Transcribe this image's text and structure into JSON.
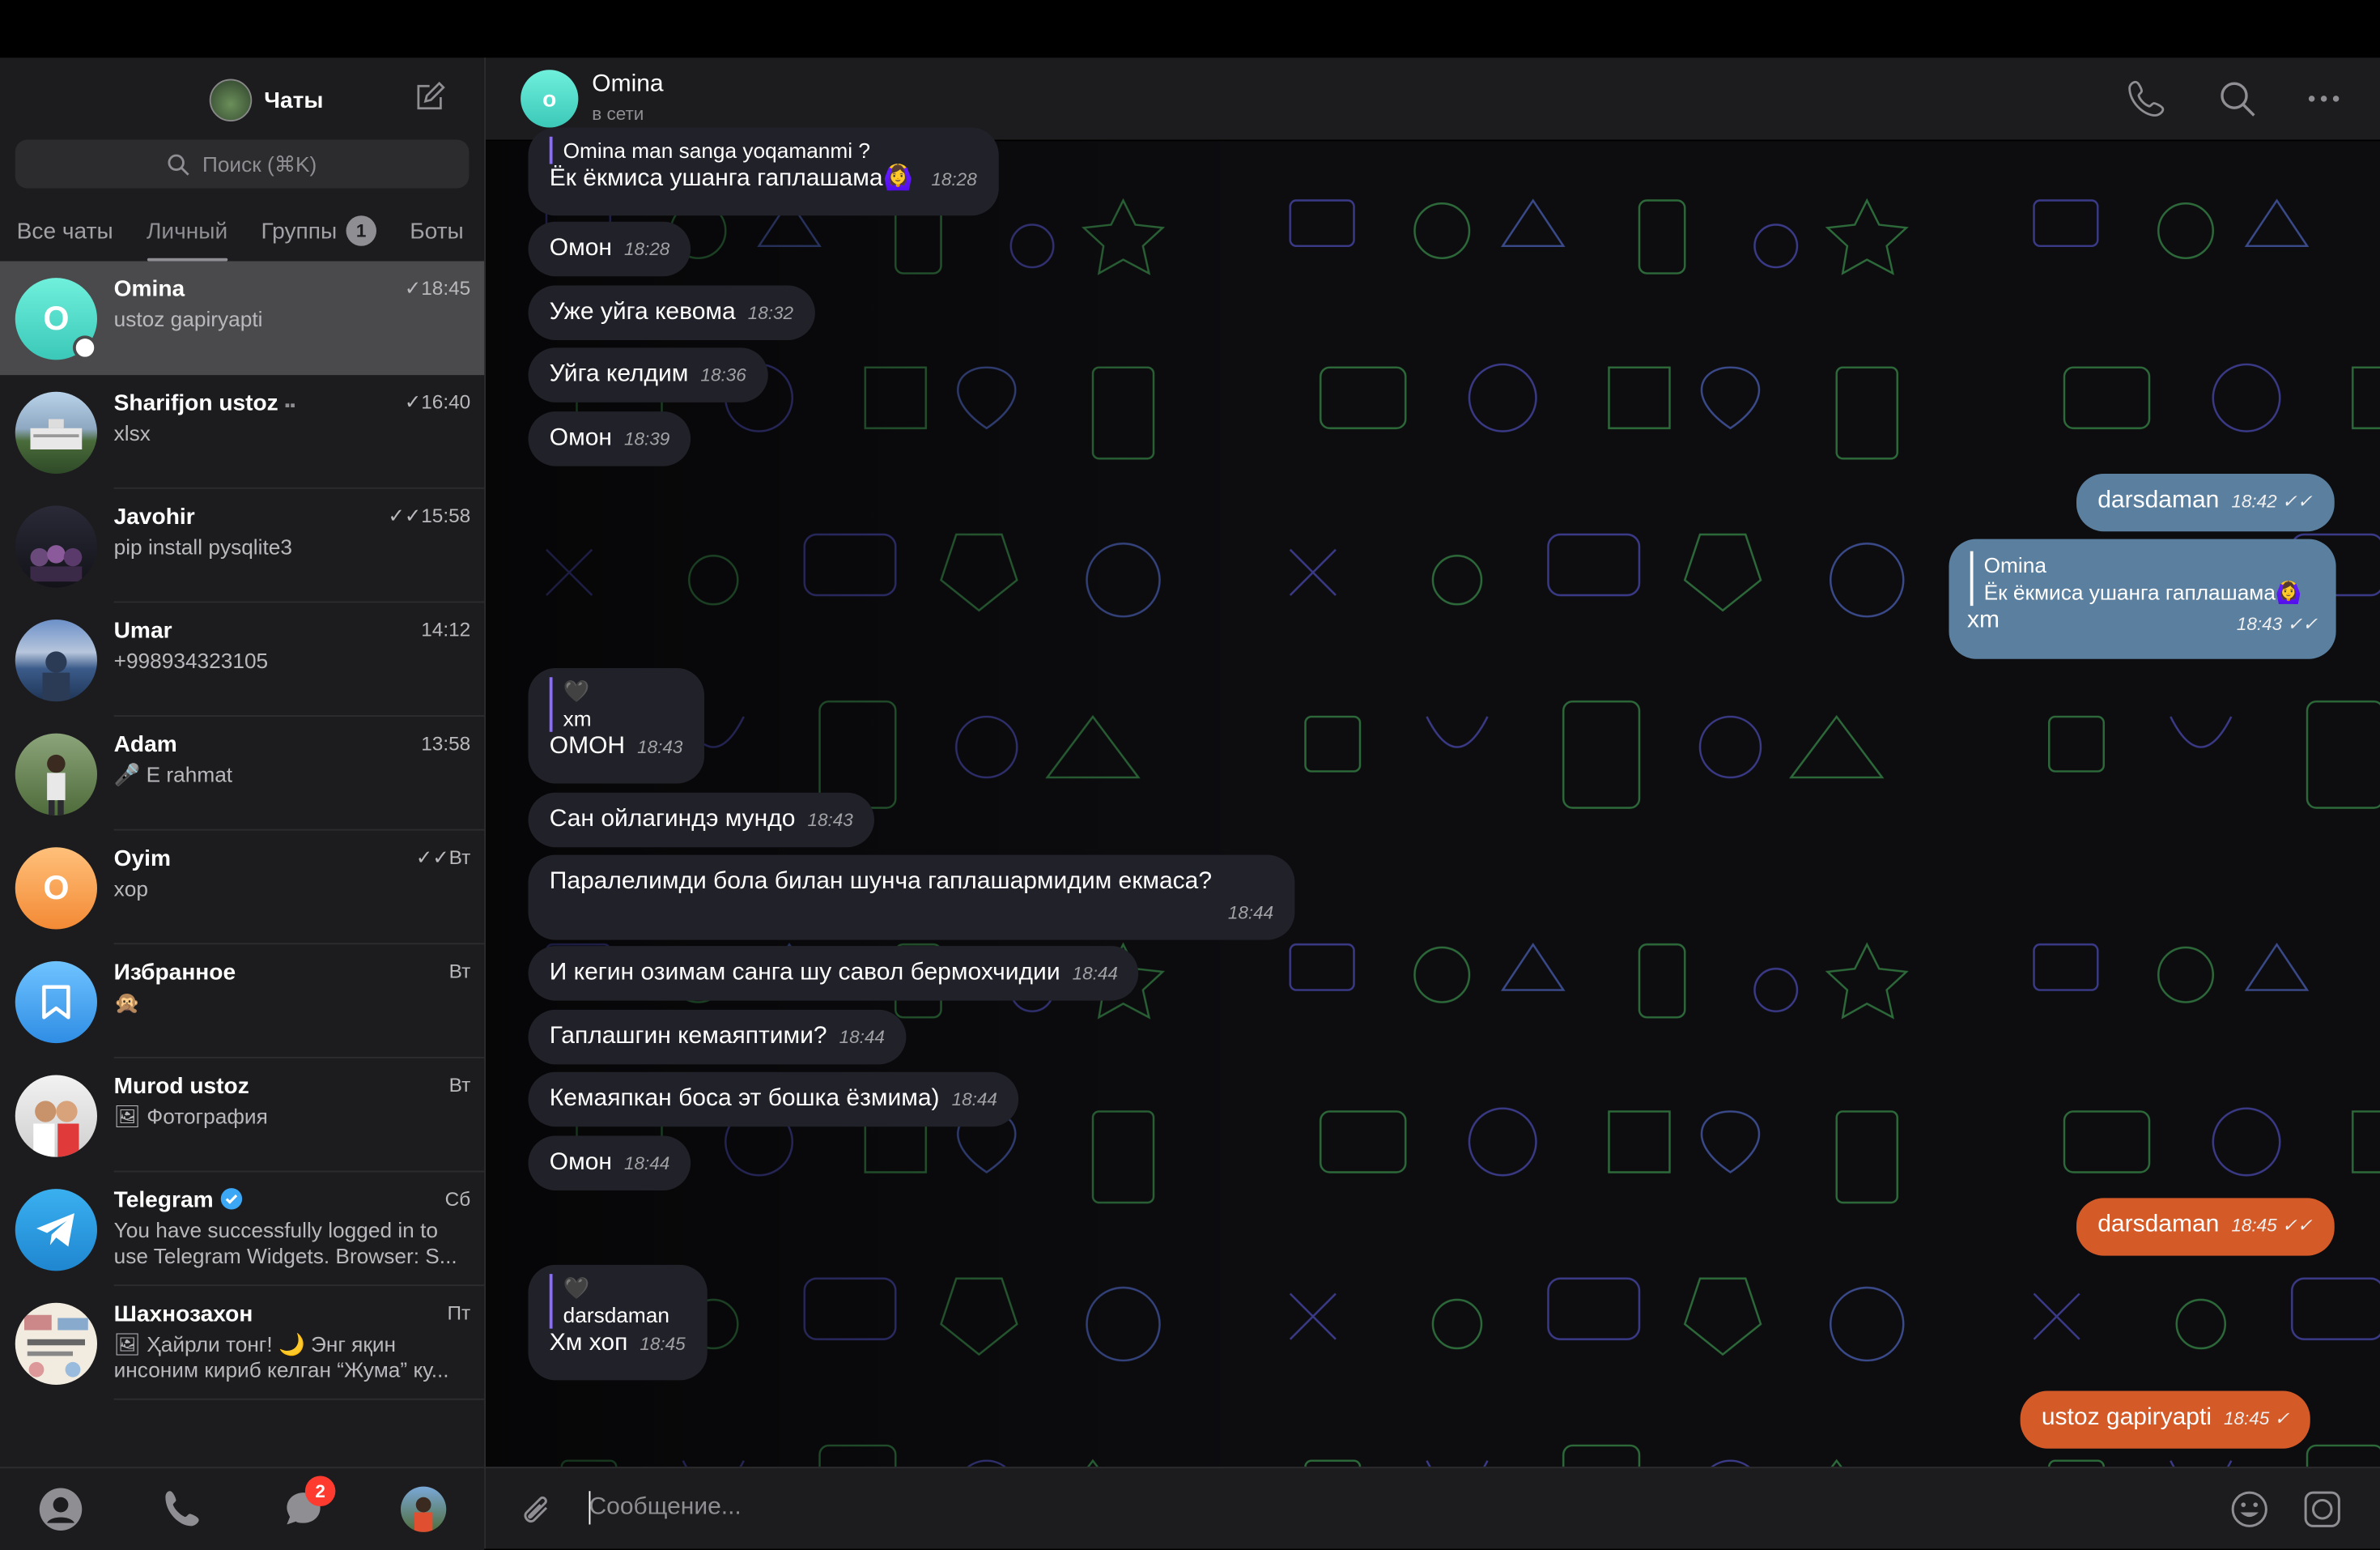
{
  "sidebar": {
    "title": "Чаты",
    "search_placeholder": "Поиск (⌘K)",
    "tabs": [
      {
        "label": "Все чаты"
      },
      {
        "label": "Личный"
      },
      {
        "label": "Группы",
        "count": "1"
      },
      {
        "label": "Боты"
      }
    ],
    "chats": [
      {
        "name": "Omina",
        "preview": "ustoz gapiryapti",
        "time": "✓18:45",
        "avatar_letter": "O",
        "avatar_color": "#40d8c8"
      },
      {
        "name": "Sharifjon ustoz",
        "preview": "xlsx",
        "time": "✓16:40"
      },
      {
        "name": "Javohir",
        "preview": "pip install pysqlite3",
        "time": "✓✓15:58"
      },
      {
        "name": "Umar",
        "preview": "+998934323105",
        "time": "14:12"
      },
      {
        "name": "Adam",
        "preview": "🎤 E rahmat",
        "time": "13:58"
      },
      {
        "name": "Oyim",
        "preview": "xop",
        "time": "✓✓Вт",
        "avatar_letter": "O",
        "avatar_color": "#f7a34b"
      },
      {
        "name": "Избранное",
        "preview": "🙊",
        "time": "Вт",
        "avatar_color": "#3ba7f5"
      },
      {
        "name": "Murod ustoz",
        "preview": "🖼 Фотография",
        "time": "Вт"
      },
      {
        "name": "Telegram",
        "preview": "You have successfully logged in to use Telegram Widgets. Browser: S...",
        "time": "Сб",
        "avatar_color": "#2f9fe4"
      },
      {
        "name": "Шахнозахон",
        "preview": "🖼 Ҳайрли тонг! 🌙 Энг яқин инсоним кириб келган “Жума” ку...",
        "time": "Пт"
      }
    ],
    "nav_badge": "2"
  },
  "chat": {
    "name": "Omina",
    "avatar_letter": "o",
    "status": "в сети",
    "composer_placeholder": "Сообщение...",
    "messages": [
      {
        "reply_name": "Omina man sanga yoqamanmi ?",
        "text": "Ёк ёкмиса ушанга гаплашама🙆‍♀️",
        "time": "18:28"
      },
      {
        "text": "Омон",
        "time": "18:28"
      },
      {
        "text": "Уже уйга кевома",
        "time": "18:32"
      },
      {
        "text": "Уйга келдим",
        "time": "18:36"
      },
      {
        "text": "Омон",
        "time": "18:39"
      },
      {
        "text": "darsdaman",
        "time": "18:42 ✓✓"
      },
      {
        "reply_name": "Omina",
        "reply_text": "Ёк ёкмиса ушанга гаплашама🙆‍♀️",
        "text": "xm",
        "time": "18:43 ✓✓"
      },
      {
        "reply_name": "🖤",
        "reply_text": "xm",
        "text": "ОМОН",
        "time": "18:43"
      },
      {
        "text": "Сан ойлагиндэ мундо",
        "time": "18:43"
      },
      {
        "text": "Паралелимди бола билан шунча гаплашармидим екмаса?",
        "time": "18:44"
      },
      {
        "text": "И кегин озимам санга шу савол бермохчидии",
        "time": "18:44"
      },
      {
        "text": "Гаплашгин кемаяптими?",
        "time": "18:44"
      },
      {
        "text": "Кемаяпкан боса эт бошка ёзмима)",
        "time": "18:44"
      },
      {
        "text": "Омон",
        "time": "18:44"
      },
      {
        "text": "darsdaman",
        "time": "18:45 ✓✓"
      },
      {
        "reply_name": "🖤",
        "reply_text": "darsdaman",
        "text": "Хм хоп",
        "time": "18:45"
      },
      {
        "text": "ustoz gapiryapti",
        "time": "18:45 ✓"
      }
    ]
  }
}
